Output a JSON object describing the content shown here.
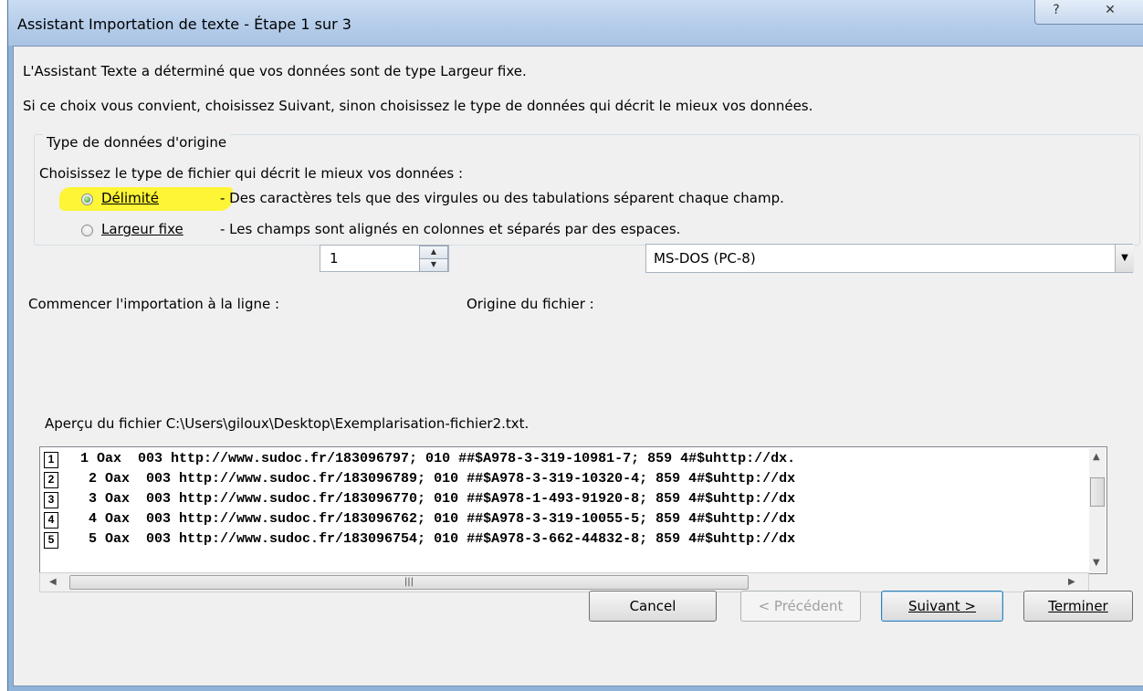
{
  "window": {
    "title": "Assistant Importation de texte - Étape 1 sur 3",
    "help_glyph": "?",
    "close_glyph": "✕"
  },
  "intro": {
    "line1": "L'Assistant Texte a déterminé que vos données sont de type Largeur fixe.",
    "line2": "Si ce choix vous convient, choisissez Suivant, sinon choisissez le type de données qui décrit le mieux vos données."
  },
  "origin_group": {
    "legend": "Type de données d'origine",
    "prompt": "Choisissez le type de fichier qui décrit le mieux vos données :",
    "options": [
      {
        "label": "Délimité",
        "description": "- Des caractères tels que des virgules ou des tabulations séparent chaque champ.",
        "selected": true
      },
      {
        "label": "Largeur fixe",
        "description": "- Les champs sont alignés en colonnes et séparés par des espaces.",
        "selected": false
      }
    ],
    "highlight_color": "#fdf535"
  },
  "start_row": {
    "label": "Commencer l'importation à la ligne :",
    "value": "1"
  },
  "file_origin": {
    "label": "Origine du fichier :",
    "value": "MS-DOS (PC-8)"
  },
  "preview": {
    "title": "Aperçu du fichier C:\\Users\\giloux\\Desktop\\Exemplarisation-fichier2.txt.",
    "rows": [
      {
        "num": "1",
        "text": "1 Oax  003 http://www.sudoc.fr/183096797; 010 ##$A978-3-319-10981-7; 859 4#$uhttp://dx."
      },
      {
        "num": "2",
        "text": " 2 Oax  003 http://www.sudoc.fr/183096789; 010 ##$A978-3-319-10320-4; 859 4#$uhttp://dx"
      },
      {
        "num": "3",
        "text": " 3 Oax  003 http://www.sudoc.fr/183096770; 010 ##$A978-1-493-91920-8; 859 4#$uhttp://dx"
      },
      {
        "num": "4",
        "text": " 4 Oax  003 http://www.sudoc.fr/183096762; 010 ##$A978-3-319-10055-5; 859 4#$uhttp://dx"
      },
      {
        "num": "5",
        "text": " 5 Oax  003 http://www.sudoc.fr/183096754; 010 ##$A978-3-662-44832-8; 859 4#$uhttp://dx"
      }
    ]
  },
  "buttons": {
    "cancel": "Cancel",
    "previous": "< Précédent",
    "next": "Suivant >",
    "finish": "Terminer"
  }
}
